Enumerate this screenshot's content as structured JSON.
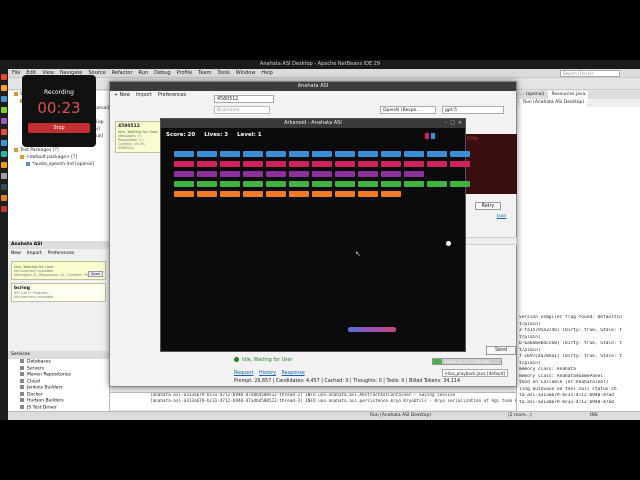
{
  "os": {
    "window_title": "Anahata ASI Desktop - Apache NetBeans IDE 29"
  },
  "netbeans": {
    "menus": [
      "File",
      "Edit",
      "View",
      "Navigate",
      "Source",
      "Refactor",
      "Run",
      "Debug",
      "Profile",
      "Team",
      "Tools",
      "Window",
      "Help"
    ],
    "search_placeholder": "Search (Ctrl+I)",
    "project_tree": [
      {
        "label": "Source Packages [5][1]",
        "indent": 1,
        "kind": "pkg"
      },
      {
        "label": "uno.anahata.asi.openai [5][1]",
        "indent": 2,
        "kind": "pkg"
      },
      {
        "label": "*OpenAiItemAdapter.java [openai]",
        "indent": 3,
        "kind": "java"
      },
      {
        "label": "*OpenAiModel.java [openai]",
        "indent": 3,
        "kind": "java"
      },
      {
        "label": "*OpenAiModelMessage.java [op",
        "indent": 3,
        "kind": "java"
      },
      {
        "label": "*OpenAiProvider.java [openai]",
        "indent": 3,
        "kind": "java"
      },
      {
        "label": "*OpenAiResponse.java [openai]",
        "indent": 3,
        "kind": "java"
      },
      {
        "label": "sendMe [A]",
        "indent": 3,
        "kind": "java"
      },
      {
        "label": "Test Packages [?]",
        "indent": 1,
        "kind": "pkg"
      },
      {
        "label": "<default package> [?]",
        "indent": 2,
        "kind": "pkg"
      },
      {
        "label": "*audio_speech.md [openai]",
        "indent": 3,
        "kind": "java"
      }
    ],
    "left_asi": {
      "title": "Anahata ASI",
      "new_label": "New",
      "import_label": "Import",
      "prefs_label": "Preferences",
      "cards": [
        {
          "id": "Idle, Waiting for User",
          "status": "No summary available",
          "meta": "Messages: 8 / Responses: 14 / Context: 99.9%",
          "open": "Open"
        },
        {
          "id": "bcriog",
          "status": "API Call in Progress...",
          "meta": "No summary available",
          "open": ""
        }
      ]
    },
    "services": {
      "title": "Services",
      "items": [
        "Databases",
        "Servers",
        "Maven Repositories",
        "Cloud",
        "Jenkins Builders",
        "Docker",
        "Hudson Builders",
        "JS Test Driver",
        "Selenium Server"
      ]
    },
    "right_panel": {
      "tabs": [
        "... (openai)",
        "Resources.java",
        "Run (Anahata ASI Desktop)"
      ],
      "log_lines": [
        "version compiler flag found. Defaultin",
        "t/plain)",
        "3-fa15795a3746] (Dirty: true, Stale: t",
        "t/plain)",
        "6-6a6a6ebdcc68] (Dirty: true, Stale: t",
        "t/plain)",
        "f-1697c4a70ea1] (Dirty: true, Stale: t",
        "t/plain)",
        "memory class: Anahata",
        "memory class: Anahata$GamePanel",
        "thod on Callable (or AnahataTool)",
        "",
        "ling autoSave on tool call status ch",
        "ta-asi-a313a679-bc31-4712-b940-d7ad",
        "ta-asi-a313a679-bc31-4712-b940-d7ad"
      ],
      "retry": "Retry",
      "json": "Json"
    },
    "output_lines": [
      "[anahata-asi-a313a679-bc31-4712-b940-d7adb4580512-thread-2] INFO uno.anahata.asi.AbstractAsiContainer - Saving session",
      "[anahata-asi-a313a679-bc31-4712-b940-d7adb4580512-thread-3] INFO uno.anahata.asi.persistence.kryo.KryoUtils - Kryo serialization of Agi took 6 ms, size: 145"
    ],
    "statusbar": {
      "run": "Run (Anahata ASI Desktop)",
      "more": "(2 more...)",
      "ins": "INS"
    }
  },
  "asi_window": {
    "title": "Anahata ASI",
    "new_label": "New",
    "import_label": "Import",
    "prefs_label": "Preferences",
    "session_id": "4580512",
    "nickname_placeholder": "Nickname",
    "provider": "OpenAI (Respo...",
    "model": "gpt-5",
    "card": {
      "id": "4580512",
      "status": "Idle, Waiting for User",
      "meta": "Messages: 9 / Responses: 1 / Context: 16.0%",
      "footer": "4580512"
    },
    "status_text": "Idle, Waiting for User",
    "send_label": "Send",
    "progress_label": "13.6% (34,114 / 250,000)",
    "progress_pct": 13.6,
    "playback": "elisa_playback.java [default]",
    "links": [
      "Request",
      "History",
      "Response"
    ],
    "prompt_stats": "Prompt: 29,657 | Candidates: 4,457 | Cached: 0 | Thoughts: 0 | Tools: 0 | Billed Tokens: 34,114",
    "right_col": {
      "retry": "Retry",
      "json": "Json",
      "error_text": "(orit 5/5%)"
    }
  },
  "game": {
    "title": "Arkanoid - Anahata ASI",
    "score_label": "Score: 20",
    "lives_label": "Lives: 3",
    "level_label": "Level: 1",
    "brick_colors": [
      "#3b8fd6",
      "#d2215f",
      "#8e2f9e",
      "#42b242",
      "#f07a25"
    ],
    "row_counts": [
      13,
      13,
      12,
      13,
      10
    ],
    "missing": [
      [
        2,
        12
      ],
      [
        4,
        13
      ]
    ],
    "ball_visible": true
  },
  "recording": {
    "label": "Recording",
    "time": "00:23",
    "stop_label": "Stop"
  }
}
